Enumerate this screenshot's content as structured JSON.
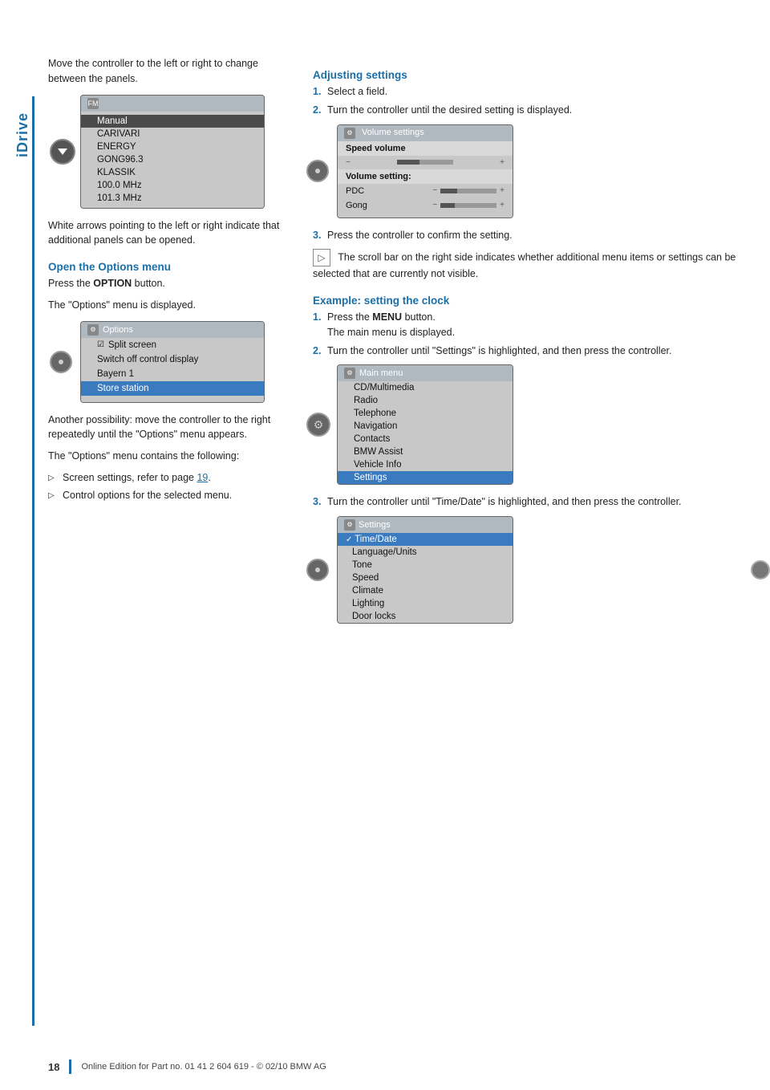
{
  "sidebar": {
    "label": "iDrive"
  },
  "left_col": {
    "intro_para": "Move the controller to the left or right to change between the panels.",
    "white_arrows_note": "White arrows pointing to the left or right indicate that additional panels can be opened.",
    "open_options_heading": "Open the Options menu",
    "open_options_step1": "Press the OPTION button.",
    "open_options_step2": "The \"Options\" menu is displayed.",
    "another_possibility": "Another possibility: move the controller to the right repeatedly until the \"Options\" menu appears.",
    "options_contains": "The \"Options\" menu contains the following:",
    "bullet1": "Screen settings, refer to page 19.",
    "bullet2": "Control options for the selected menu.",
    "fm_screen": {
      "title": "FM",
      "rows": [
        "Manual",
        "CARIVARI",
        "ENERGY",
        "GONG96.3",
        "KLASSIK",
        "100.0 MHz",
        "101.3 MHz"
      ]
    },
    "options_screen": {
      "title": "Options",
      "rows": [
        {
          "label": "Split screen",
          "icon": "check",
          "highlighted": false
        },
        {
          "label": "Switch off control display",
          "highlighted": false
        },
        {
          "label": "Bayern 1",
          "highlighted": false
        },
        {
          "label": "Store station",
          "highlighted": true
        }
      ]
    }
  },
  "right_col": {
    "adjusting_heading": "Adjusting settings",
    "adj_step1_num": "1.",
    "adj_step1": "Select a field.",
    "adj_step2_num": "2.",
    "adj_step2": "Turn the controller until the desired setting is displayed.",
    "adj_step3_num": "3.",
    "adj_step3": "Press the controller to confirm the setting.",
    "scroll_note": "The scroll bar on the right side indicates whether additional menu items or settings can be selected that are currently not visible.",
    "volume_screen": {
      "title": "Volume settings",
      "speed_vol_label": "Speed volume",
      "minus": "−",
      "plus": "+",
      "vol_setting_label": "Volume setting:",
      "pdc_label": "PDC",
      "gong_label": "Gong",
      "fill_percent": 40
    },
    "example_heading": "Example: setting the clock",
    "ex_step1_num": "1.",
    "ex_step1a": "Press the MENU button.",
    "ex_step1b": "The main menu is displayed.",
    "ex_step2_num": "2.",
    "ex_step2": "Turn the controller until \"Settings\" is highlighted, and then press the controller.",
    "ex_step3_num": "3.",
    "ex_step3": "Turn the controller until \"Time/Date\" is highlighted, and then press the controller.",
    "main_menu_screen": {
      "title": "Main menu",
      "rows": [
        {
          "label": "CD/Multimedia",
          "highlighted": false
        },
        {
          "label": "Radio",
          "highlighted": false
        },
        {
          "label": "Telephone",
          "highlighted": false
        },
        {
          "label": "Navigation",
          "highlighted": false
        },
        {
          "label": "Contacts",
          "highlighted": false
        },
        {
          "label": "BMW Assist",
          "highlighted": false
        },
        {
          "label": "Vehicle Info",
          "highlighted": false
        },
        {
          "label": "Settings",
          "highlighted": true
        }
      ]
    },
    "settings_screen": {
      "title": "Settings",
      "rows": [
        {
          "label": "Time/Date",
          "check": true,
          "highlighted": true
        },
        {
          "label": "Language/Units",
          "highlighted": false
        },
        {
          "label": "Tone",
          "highlighted": false
        },
        {
          "label": "Speed",
          "highlighted": false
        },
        {
          "label": "Climate",
          "highlighted": false
        },
        {
          "label": "Lighting",
          "highlighted": false
        },
        {
          "label": "Door locks",
          "highlighted": false
        }
      ]
    }
  },
  "footer": {
    "page_num": "18",
    "text": "Online Edition for Part no. 01 41 2 604 619 - © 02/10 BMW AG"
  }
}
